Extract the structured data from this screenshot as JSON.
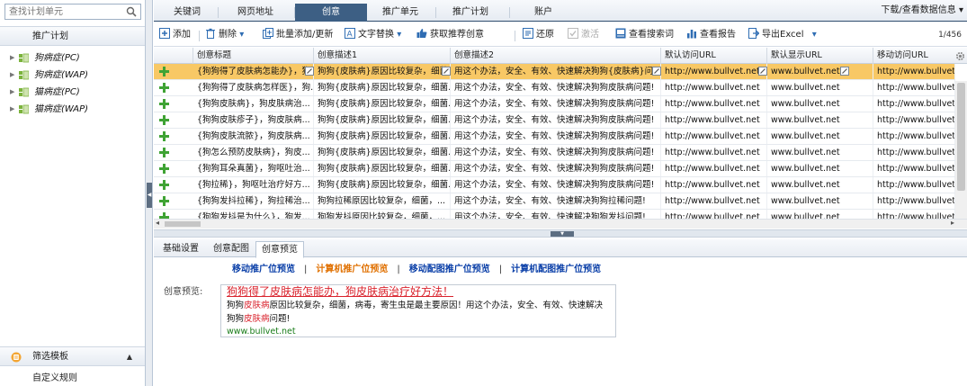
{
  "colors": {
    "accent": "#3d5f84",
    "selected_row": "#f8c865",
    "highlight_red": "#d9232d",
    "url_green": "#1a7d1a",
    "preview_blue": "#0a3fa8",
    "preview_active_orange": "#e07000"
  },
  "sidebar": {
    "search_placeholder": "查找计划单元",
    "plan_header": "推广计划",
    "items": [
      {
        "label": "狗病症(PC)",
        "icon": "folder-icon"
      },
      {
        "label": "狗病症(WAP)",
        "icon": "folder-icon"
      },
      {
        "label": "猫病症(PC)",
        "icon": "folder-icon"
      },
      {
        "label": "猫病症(WAP)",
        "icon": "folder-icon"
      }
    ],
    "filter_template": "筛选模板",
    "custom_rules": "自定义规则"
  },
  "tabs": [
    "关键词",
    "网页地址",
    "创意",
    "推广单元",
    "推广计划",
    "账户"
  ],
  "active_tab": "创意",
  "download_label": "下载/查看数据信息",
  "toolbar": {
    "add": "添加",
    "delete": "删除",
    "batch_add": "批量添加/更新",
    "text_replace": "文字替换",
    "get_recommend": "获取推荐创意",
    "restore": "还原",
    "activate": "激活",
    "view_search_terms": "查看搜索词",
    "view_report": "查看报告",
    "export_excel": "导出Excel",
    "pager": "1/456"
  },
  "grid": {
    "columns": [
      "创意标题",
      "创意描述1",
      "创意描述2",
      "默认访问URL",
      "默认显示URL",
      "移动访问URL"
    ],
    "rows": [
      [
        "{狗狗得了皮肤病怎能办}，狗狗...",
        "狗狗{皮肤病}原因比较复杂，细菌...",
        "用这个办法，安全、有效、快速解决狗狗{皮肤病}问题!",
        "http://www.bullvet.net",
        "www.bullvet.net",
        "http://www.bullvet..."
      ],
      [
        "{狗狗得了皮肤病怎样医}，狗...",
        "狗狗{皮肤病}原因比较复杂，细菌...",
        "用这个办法，安全、有效、快速解决狗狗皮肤病问题!",
        "http://www.bullvet.net",
        "www.bullvet.net",
        "http://www.bullvet..."
      ],
      [
        "{狗狗皮肤病}，狗皮肤病治...",
        "狗狗{皮肤病}原因比较复杂，细菌...",
        "用这个办法，安全、有效、快速解决狗狗皮肤病问题!",
        "http://www.bullvet.net",
        "www.bullvet.net",
        "http://www.bullvet..."
      ],
      [
        "{狗狗皮肤疹子}，狗皮肤病...",
        "狗狗{皮肤病}原因比较复杂，细菌...",
        "用这个办法，安全、有效、快速解决狗狗皮肤病问题!",
        "http://www.bullvet.net",
        "www.bullvet.net",
        "http://www.bullvet..."
      ],
      [
        "{狗狗皮肤流脓}，狗皮肤病...",
        "狗狗{皮肤病}原因比较复杂，细菌...",
        "用这个办法，安全、有效、快速解决狗狗皮肤病问题!",
        "http://www.bullvet.net",
        "www.bullvet.net",
        "http://www.bullvet..."
      ],
      [
        "{狗怎么预防皮肤病}，狗皮...",
        "狗狗{皮肤病}原因比较复杂，细菌...",
        "用这个办法，安全、有效、快速解决狗狗皮肤病问题!",
        "http://www.bullvet.net",
        "www.bullvet.net",
        "http://www.bullvet..."
      ],
      [
        "{狗狗耳朵真菌}，狗呕吐治...",
        "狗狗{皮肤病}原因比较复杂，细菌...",
        "用这个办法，安全、有效、快速解决狗狗皮肤病问题!",
        "http://www.bullvet.net",
        "www.bullvet.net",
        "http://www.bullvet..."
      ],
      [
        "{狗拉稀}，狗呕吐治疗好方...",
        "狗狗{皮肤病}原因比较复杂，细菌...",
        "用这个办法，安全、有效、快速解决狗狗皮肤病问题!",
        "http://www.bullvet.net",
        "www.bullvet.net",
        "http://www.bullvet..."
      ],
      [
        "{狗狗发抖拉稀}，狗拉稀治...",
        "狗狗拉稀原因比较复杂，细菌，...",
        "用这个办法，安全、有效、快速解决狗狗拉稀问题!",
        "http://www.bullvet.net",
        "www.bullvet.net",
        "http://www.bullvet..."
      ],
      [
        "{狗狗发抖是为什么}，狗发...",
        "狗狗发抖原因比较复杂，细菌，...",
        "用这个办法，安全、有效、快速解决狗狗发抖问题!",
        "http://www.bullvet.net",
        "www.bullvet.net",
        "http://www.bullvet..."
      ]
    ],
    "selected_row": 0
  },
  "detail_tabs": [
    "基础设置",
    "创意配图",
    "创意预览"
  ],
  "active_detail_tab": "创意预览",
  "preview": {
    "links": [
      "移动推广位预览",
      "计算机推广位预览",
      "移动配图推广位预览",
      "计算机配图推广位预览"
    ],
    "active_link": 1,
    "label": "创意预览:",
    "title": "狗狗得了皮肤病怎能办，狗皮肤病治疗好方法！",
    "desc_parts": [
      "狗狗",
      "皮肤病",
      "原因比较复杂，细菌，病毒，寄生虫是最主要原因！用这个办法，安全、有效、快速解决狗狗",
      "皮肤病",
      "问题!"
    ],
    "url": "www.bullvet.net"
  }
}
